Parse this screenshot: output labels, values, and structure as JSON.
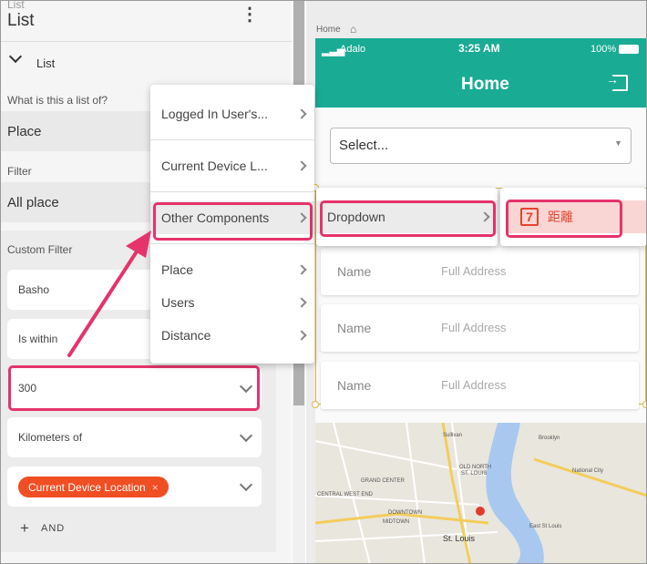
{
  "panel": {
    "breadcrumb": "List",
    "title": "List",
    "section_label": "List",
    "q_list_of": "What is this a list of?",
    "list_of_value": "Place",
    "filter_label": "Filter",
    "filter_value": "All place",
    "custom_filter_label": "Custom Filter",
    "field_basho": "Basho",
    "field_within": "Is within",
    "field_distance": "300",
    "field_unit": "Kilometers of",
    "chip_label": "Current Device Location",
    "chip_close": "×",
    "add_and": "AND"
  },
  "menu": {
    "items": [
      "Logged In User's...",
      "Current Device L...",
      "Other Components",
      "Place",
      "Users",
      "Distance"
    ]
  },
  "submenu1": {
    "item": "Dropdown"
  },
  "submenu2": {
    "item": "距離",
    "icon_text": "7"
  },
  "app": {
    "screen_label": "Home",
    "carrier": "Adalo",
    "time": "3:25 AM",
    "battery": "100%",
    "header_title": "Home",
    "select_placeholder": "Select...",
    "rows": [
      {
        "name": "Name",
        "address": "Full Address"
      },
      {
        "name": "Name",
        "address": "Full Address"
      },
      {
        "name": "Name",
        "address": "Full Address"
      }
    ]
  },
  "map": {
    "labels": [
      "Sullivan",
      "Brooklyn",
      "OLD NORTH",
      "ST. LOUIS",
      "GRAND CENTER",
      "National City",
      "CENTRAL WEST END",
      "DOWNTOWN",
      "MIDTOWN",
      "St. Louis",
      "East St Louis"
    ]
  },
  "colors": {
    "accent": "#1aab94",
    "highlight": "#e5336b",
    "chip": "#f04e23"
  }
}
